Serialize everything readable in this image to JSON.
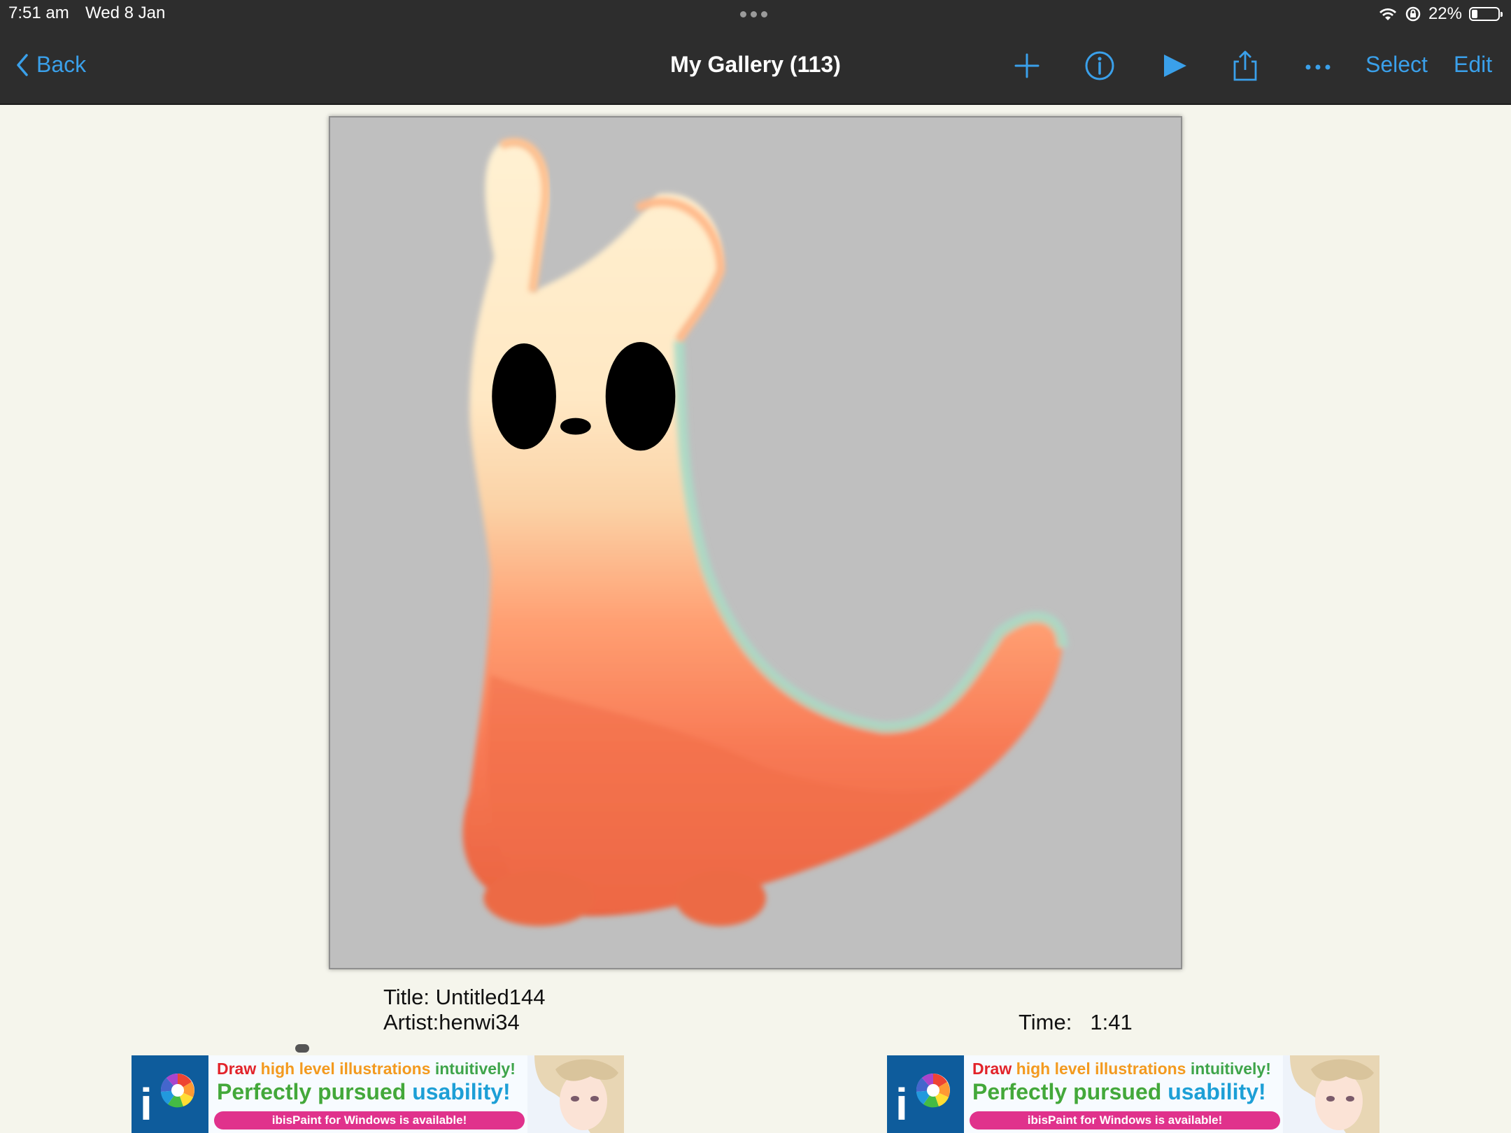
{
  "status_bar": {
    "time": "7:51 am",
    "date": "Wed 8 Jan",
    "battery": "22%",
    "icons": [
      "wifi-icon",
      "orientation-lock-icon",
      "battery-icon"
    ]
  },
  "nav": {
    "back_label": "Back",
    "title": "My Gallery (113)",
    "icons": [
      "add-icon",
      "info-icon",
      "play-icon",
      "share-icon",
      "more-icon"
    ],
    "select_label": "Select",
    "edit_label": "Edit",
    "accent_color": "#3aa0ea"
  },
  "artwork": {
    "description_icon": "creature-artwork-image",
    "background_color": "#bfbfbf"
  },
  "info": {
    "title_line": "Title: Untitled144",
    "artist_line": "Artist:henwi34",
    "time_label": "Time:",
    "time_value": "1:41"
  },
  "ads": [
    {
      "line1_draw": "Draw",
      "line1_high": "high level illustrations",
      "line1_intuitively": "intuitively!",
      "line2_perfectly": "Perfectly pursued",
      "line2_usability": "usability!",
      "pill": "ibisPaint for Windows is available!",
      "logo_text": "i"
    },
    {
      "line1_draw": "Draw",
      "line1_high": "high level illustrations",
      "line1_intuitively": "intuitively!",
      "line2_perfectly": "Perfectly pursued",
      "line2_usability": "usability!",
      "pill": "ibisPaint for Windows is available!",
      "logo_text": "i"
    }
  ]
}
